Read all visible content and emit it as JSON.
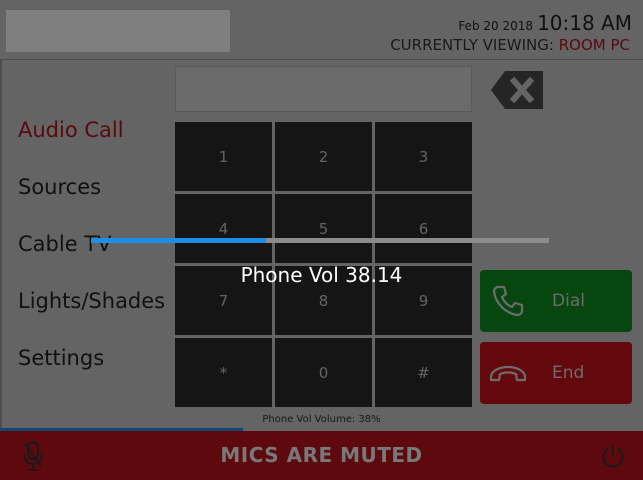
{
  "header": {
    "date": "Feb 20 2018",
    "time": "10:18 AM",
    "viewing_prefix": "CURRENTLY VIEWING: ",
    "viewing_room": "ROOM PC"
  },
  "sidebar": {
    "items": [
      {
        "label": "Audio Call",
        "active": true
      },
      {
        "label": "Sources"
      },
      {
        "label": "Cable TV"
      },
      {
        "label": "Lights/Shades"
      },
      {
        "label": "Settings"
      }
    ]
  },
  "dialpad": {
    "display_value": "",
    "keys": [
      "1",
      "2",
      "3",
      "4",
      "5",
      "6",
      "7",
      "8",
      "9",
      "*",
      "0",
      "#"
    ],
    "dial_label": "Dial",
    "end_label": "End"
  },
  "footer": {
    "volume_caption": "Phone Vol Volume: 38%",
    "mute_text": "MICS ARE MUTED"
  },
  "volume_overlay": {
    "label": "Phone Vol 38.14",
    "level_percent": 38.14
  },
  "colors": {
    "accent_red": "#b5121b",
    "dial_green": "#0f8d1c",
    "end_red": "#c6121b",
    "progress_blue": "#1b8ee8"
  },
  "icons": [
    "backspace-icon",
    "phone-icon",
    "hangup-icon",
    "mic-muted-icon",
    "power-icon"
  ]
}
